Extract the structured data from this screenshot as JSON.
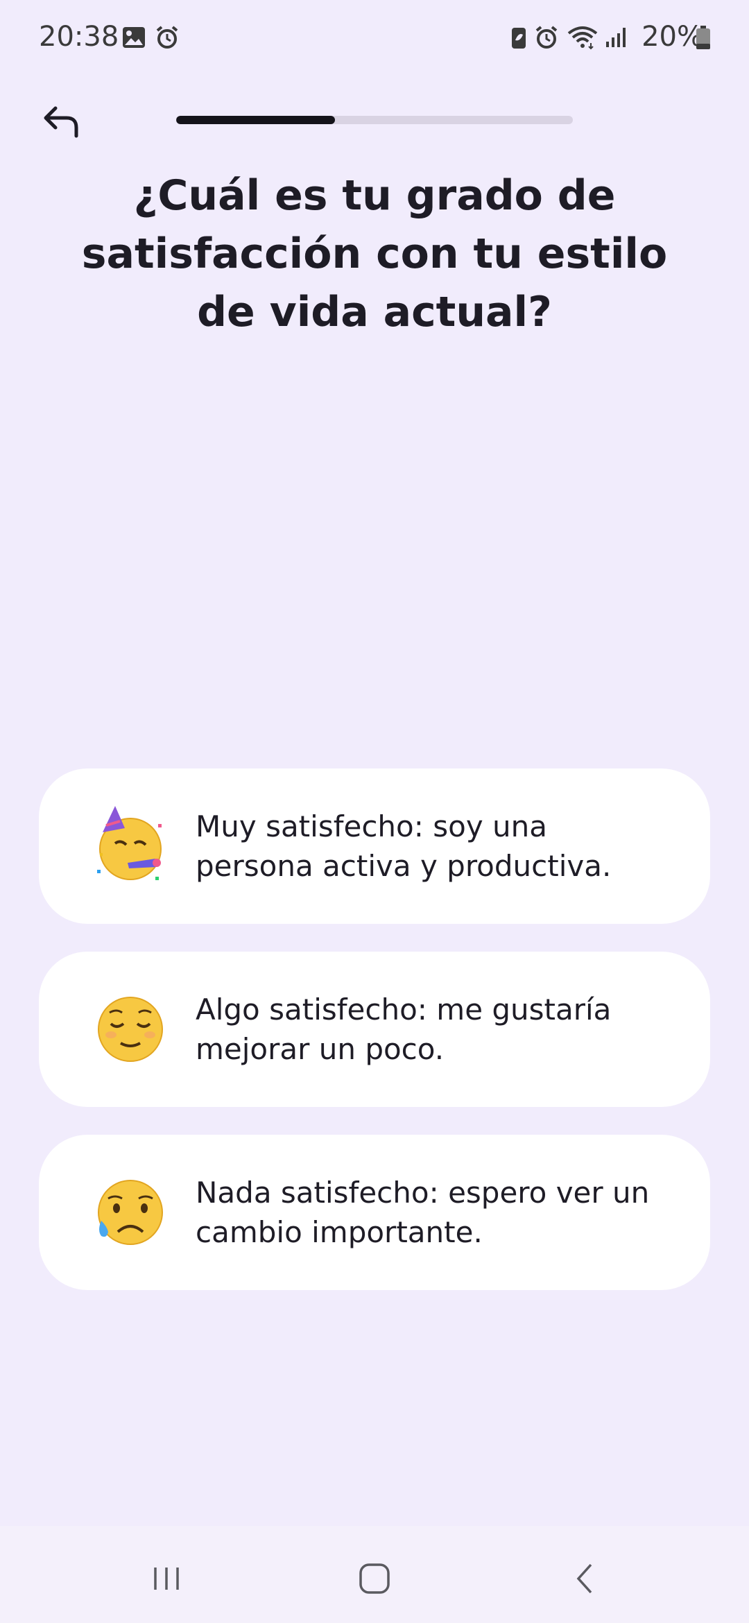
{
  "status_bar": {
    "time": "20:38",
    "battery_percent": "20%",
    "icons_left": [
      "gallery-icon",
      "alarm-icon"
    ],
    "icons_right": [
      "battery-saver-icon",
      "alarm-icon",
      "wifi-icon",
      "signal-icon",
      "battery-icon"
    ]
  },
  "progress": {
    "fraction": 0.4
  },
  "question": {
    "text": "¿Cuál es tu grado de satisfacción con tu estilo de vida actual?"
  },
  "options": [
    {
      "emoji": "partying-face-icon",
      "label": "Muy satisfecho: soy una persona activa y productiva."
    },
    {
      "emoji": "relieved-face-icon",
      "label": "Algo satisfecho: me gustaría mejorar un poco."
    },
    {
      "emoji": "sad-sweat-face-icon",
      "label": "Nada satisfecho: espero ver un cambio importante."
    }
  ],
  "nav": {
    "buttons": [
      "recent-apps-icon",
      "home-icon",
      "back-nav-icon"
    ]
  },
  "colors": {
    "background": "#f1ecfc",
    "card": "#ffffff",
    "progress_fill": "#14131a",
    "progress_track": "#d9d3e3",
    "text": "#1e1c26"
  }
}
